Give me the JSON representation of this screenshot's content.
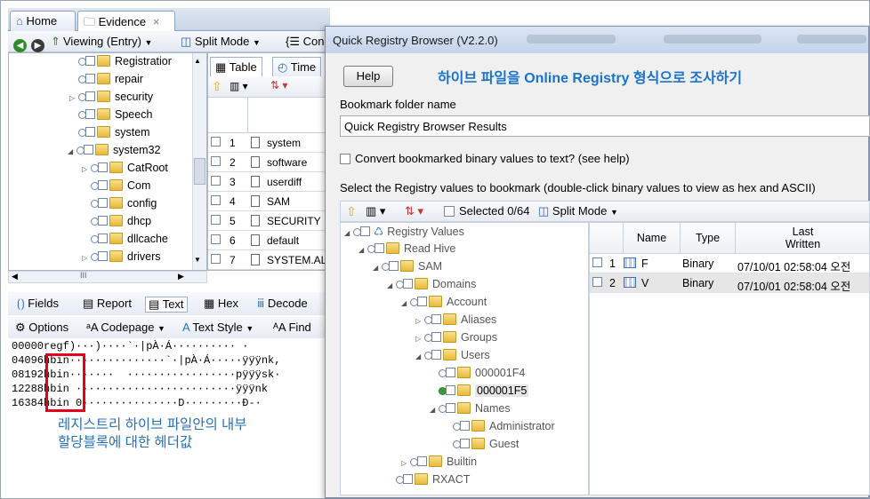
{
  "left_window": {
    "tabs": [
      {
        "label": "Home"
      },
      {
        "label": "Evidence",
        "close": "×"
      }
    ],
    "toolbar": {
      "viewing_label": "Viewing (Entry)",
      "split_mode_label": "Split Mode",
      "cond_label": "Cond"
    },
    "tree_items": [
      {
        "label": "Registratior"
      },
      {
        "label": "repair"
      },
      {
        "label": "security"
      },
      {
        "label": "Speech"
      },
      {
        "label": "system"
      },
      {
        "label": "system32"
      },
      {
        "label": "CatRoot"
      },
      {
        "label": "Com"
      },
      {
        "label": "config"
      },
      {
        "label": "dhcp"
      },
      {
        "label": "dllcache"
      },
      {
        "label": "drivers"
      }
    ],
    "scroll_mid": "III",
    "table_tabs": {
      "table": "Table",
      "timeline": "Time"
    },
    "table_rows": [
      {
        "num": "1",
        "name": "system"
      },
      {
        "num": "2",
        "name": "software"
      },
      {
        "num": "3",
        "name": "userdiff"
      },
      {
        "num": "4",
        "name": "SAM"
      },
      {
        "num": "5",
        "name": "SECURITY"
      },
      {
        "num": "6",
        "name": "default"
      },
      {
        "num": "7",
        "name": "SYSTEM.ALT"
      }
    ],
    "bottom_tabs": {
      "fields": "Fields",
      "report": "Report",
      "text": "Text",
      "hex": "Hex",
      "decode": "Decode"
    },
    "text_toolbar": {
      "options": "Options",
      "codepage": "Codepage",
      "text_style": "Text Style",
      "find": "Find"
    },
    "hex_lines": [
      {
        "offset": "00000",
        "content": "regf)···)····`·|pÀ·Á·········· ·"
      },
      {
        "offset": "04096",
        "content": "hbin···············`·|pÀ·Á·····ÿÿÿnk,"
      },
      {
        "offset": "08192",
        "content": "hbin·······  ·················pÿÿÿsk·"
      },
      {
        "offset": "12288",
        "content": "hbin ·························ÿÿÿnk"
      },
      {
        "offset": "16384",
        "content": "hbin 0···············D·········Ð-·"
      }
    ],
    "annotation": "레지스트리 하이브 파일안의 내부\n할당블록에 대한 헤더값"
  },
  "dialog": {
    "title": "Quick Registry Browser (V2.2.0)",
    "help_button": "Help",
    "headline": "하이브 파일을 Online Registry 형식으로 조사하기",
    "bookmark_folder_label": "Bookmark folder name",
    "bookmark_folder_value": "Quick Registry Browser Results",
    "convert_checkbox_label": "Convert bookmarked binary values to text? (see help)",
    "select_label": "Select the Registry values to bookmark (double-click binary values to view as hex and ASCII)",
    "toolbar": {
      "selected": "Selected 0/64",
      "split_mode": "Split Mode"
    },
    "tree": [
      {
        "label": "Registry Values"
      },
      {
        "label": "Read Hive"
      },
      {
        "label": "SAM"
      },
      {
        "label": "Domains"
      },
      {
        "label": "Account"
      },
      {
        "label": "Aliases"
      },
      {
        "label": "Groups"
      },
      {
        "label": "Users"
      },
      {
        "label": "000001F4"
      },
      {
        "label": "000001F5"
      },
      {
        "label": "Names"
      },
      {
        "label": "Administrator"
      },
      {
        "label": "Guest"
      },
      {
        "label": "Builtin"
      },
      {
        "label": "RXACT"
      }
    ],
    "grid": {
      "columns": {
        "name": "Name",
        "type": "Type",
        "last_written": "Last\nWritten"
      },
      "rows": [
        {
          "num": "1",
          "name": "F",
          "type": "Binary",
          "written": "07/10/01 02:58:04 오전"
        },
        {
          "num": "2",
          "name": "V",
          "type": "Binary",
          "written": "07/10/01 02:58:04 오전"
        }
      ]
    }
  },
  "colors": {
    "accent_blue": "#1b73c8",
    "annotation_blue": "#2a6fb5",
    "highlight_red": "#e3001b"
  }
}
